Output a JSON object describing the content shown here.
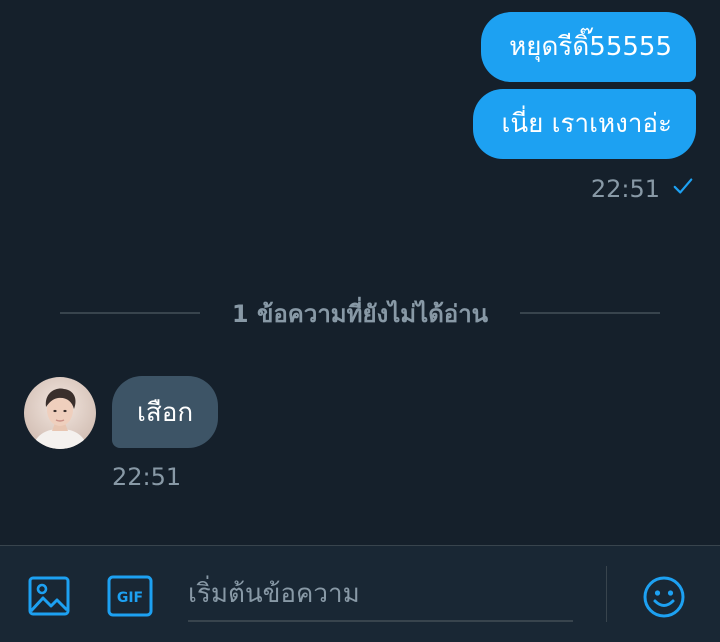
{
  "messages_out": [
    {
      "text": "หยุดรีดิ๊55555"
    },
    {
      "text": "เนี่ย เราเหงาอ่ะ"
    }
  ],
  "out_time": "22:51",
  "out_status_icon": "check-icon",
  "unread_divider": "1 ข้อความที่ยังไม่ได้อ่าน",
  "message_in": {
    "text": "เสือก",
    "time": "22:51",
    "avatar_icon": "avatar"
  },
  "composer": {
    "placeholder": "เริ่มต้นข้อความ",
    "image_icon": "image-icon",
    "gif_label": "GIF",
    "emoji_icon": "emoji-icon"
  },
  "colors": {
    "background": "#15202b",
    "accent": "#1da1f2",
    "incoming_bubble": "#3d5466",
    "muted_text": "#8899a6",
    "composer_bg": "#192734"
  }
}
